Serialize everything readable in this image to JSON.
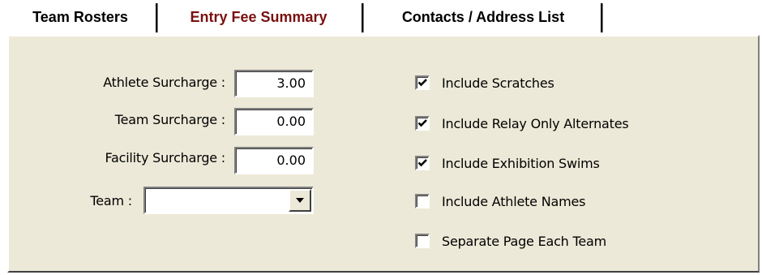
{
  "tabs": [
    {
      "label": "Team Rosters",
      "active": false
    },
    {
      "label": "Entry Fee Summary",
      "active": true
    },
    {
      "label": "Contacts / Address List",
      "active": false
    }
  ],
  "form": {
    "athlete_surcharge": {
      "label": "Athlete Surcharge :",
      "value": "3.00"
    },
    "team_surcharge": {
      "label": "Team Surcharge :",
      "value": "0.00"
    },
    "facility_surcharge": {
      "label": "Facility Surcharge :",
      "value": "0.00"
    },
    "team": {
      "label": "Team :",
      "value": ""
    }
  },
  "options": [
    {
      "label": "Include Scratches",
      "checked": true
    },
    {
      "label": "Include Relay Only Alternates",
      "checked": true
    },
    {
      "label": "Include Exhibition Swims",
      "checked": true
    },
    {
      "label": "Include Athlete Names",
      "checked": false
    },
    {
      "label": "Separate Page Each Team",
      "checked": false
    }
  ],
  "colors": {
    "panel_bg": "#ece9d8",
    "active_tab_text": "#7a1010"
  },
  "icons": {
    "dropdown": "chevron-down-icon",
    "check": "check-icon"
  }
}
